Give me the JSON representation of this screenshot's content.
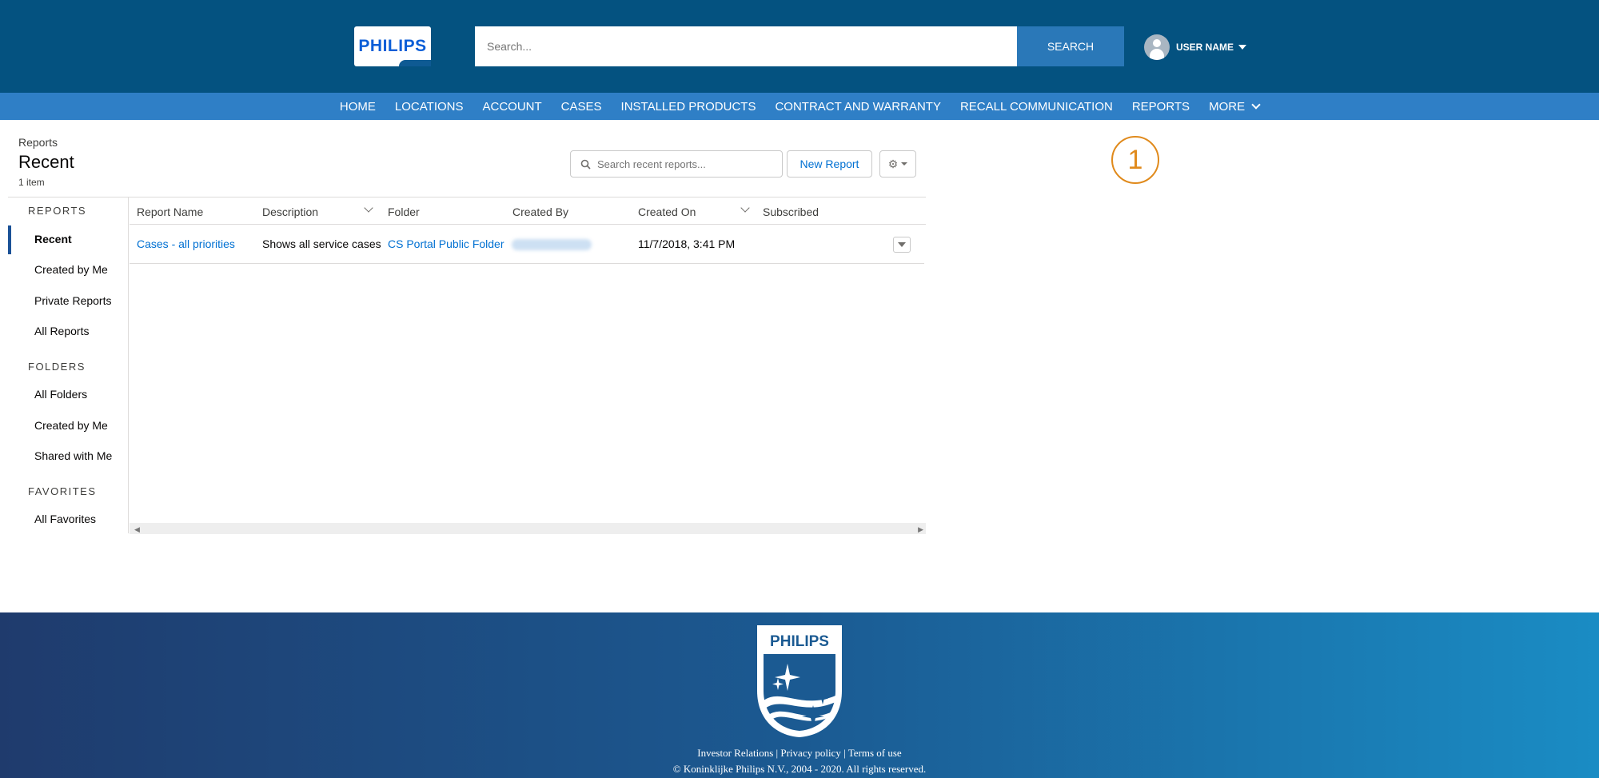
{
  "header": {
    "logo_text": "PHILIPS",
    "search_placeholder": "Search...",
    "search_button": "SEARCH",
    "user_name": "USER NAME"
  },
  "nav": {
    "items": [
      "HOME",
      "LOCATIONS",
      "ACCOUNT",
      "CASES",
      "INSTALLED PRODUCTS",
      "CONTRACT AND WARRANTY",
      "RECALL COMMUNICATION",
      "REPORTS"
    ],
    "more": "MORE"
  },
  "page": {
    "breadcrumb": "Reports",
    "title": "Recent",
    "item_count": "1 item",
    "search_placeholder": "Search recent reports...",
    "new_report_button": "New Report",
    "step_badge": "1"
  },
  "sidebar": {
    "reports_heading": "REPORTS",
    "reports_items": [
      "Recent",
      "Created by Me",
      "Private Reports",
      "All Reports"
    ],
    "folders_heading": "FOLDERS",
    "folders_items": [
      "All Folders",
      "Created by Me",
      "Shared with Me"
    ],
    "favorites_heading": "FAVORITES",
    "favorites_items": [
      "All Favorites"
    ]
  },
  "table": {
    "columns": [
      "Report Name",
      "Description",
      "Folder",
      "Created By",
      "Created On",
      "Subscribed"
    ],
    "rows": [
      {
        "report_name": "Cases - all priorities",
        "description": "Shows all service cases",
        "folder": "CS Portal Public Folder",
        "created_on": "11/7/2018, 3:41 PM",
        "subscribed": ""
      }
    ]
  },
  "footer": {
    "logo_text": "PHILIPS",
    "links": [
      "Investor Relations",
      "Privacy policy",
      "Terms of use"
    ],
    "copyright": "© Koninklijke Philips N.V., 2004 - 2020. All rights reserved."
  },
  "colors": {
    "header_bg": "#045280",
    "nav_bg": "#2f7fc6",
    "link": "#0070d2",
    "badge": "#e08a1c"
  }
}
